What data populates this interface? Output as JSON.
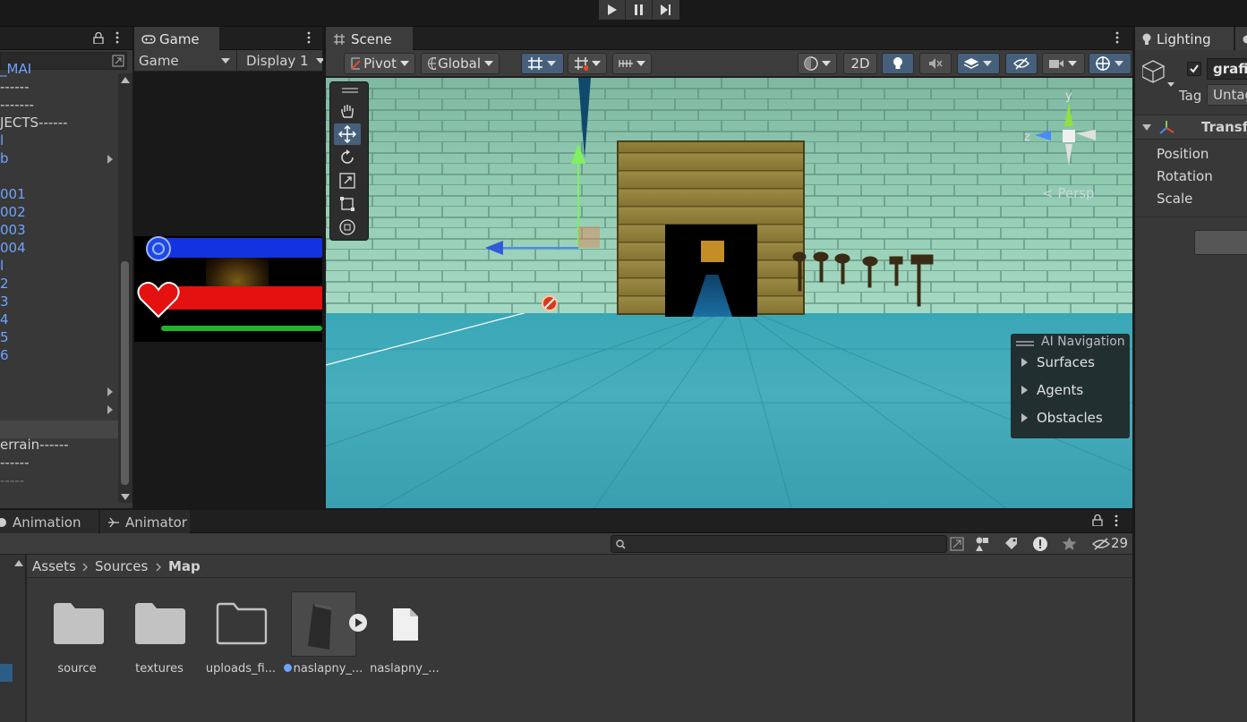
{
  "topbar": {
    "play_icon": "play-icon",
    "pause_icon": "pause-icon",
    "step_icon": "step-icon"
  },
  "hierarchy": {
    "items": [
      {
        "text": "_MAI",
        "cls": "blue"
      },
      {
        "text": "------",
        "cls": ""
      },
      {
        "text": "-------",
        "cls": ""
      },
      {
        "text": "JECTS------",
        "cls": ""
      },
      {
        "text": "l",
        "cls": "blue"
      },
      {
        "text": "b",
        "cls": "blue"
      },
      {
        "text": "",
        "cls": ""
      },
      {
        "text": "001",
        "cls": "blue"
      },
      {
        "text": "002",
        "cls": "blue"
      },
      {
        "text": "003",
        "cls": "blue"
      },
      {
        "text": "004",
        "cls": "blue"
      },
      {
        "text": "l",
        "cls": "blue"
      },
      {
        "text": "2",
        "cls": "blue"
      },
      {
        "text": "3",
        "cls": "blue"
      },
      {
        "text": "4",
        "cls": "blue"
      },
      {
        "text": "5",
        "cls": "blue"
      },
      {
        "text": "6",
        "cls": "blue"
      },
      {
        "text": "",
        "cls": ""
      },
      {
        "text": "",
        "cls": ""
      },
      {
        "text": "",
        "cls": ""
      },
      {
        "text": "",
        "cls": ""
      },
      {
        "text": "errain------",
        "cls": ""
      },
      {
        "text": "------",
        "cls": ""
      },
      {
        "text": "-----",
        "cls": "dim"
      }
    ]
  },
  "game": {
    "tab_label": "Game",
    "dropdown_game": "Game",
    "dropdown_display": "Display 1"
  },
  "scene": {
    "tab_label": "Scene",
    "pivot_label": "Pivot",
    "global_label": "Global",
    "mode_2d": "2D",
    "persp_label": "< Persp",
    "gizmo_y": "y",
    "gizmo_z": "z"
  },
  "ai_navigation": {
    "title": "AI Navigation",
    "items": [
      "Surfaces",
      "Agents",
      "Obstacles"
    ]
  },
  "inspector": {
    "tab_label": "Lighting",
    "object_name": "grafit",
    "tag_label": "Tag",
    "tag_value": "Untag",
    "transform_label": "Transfo",
    "position_label": "Position",
    "rotation_label": "Rotation",
    "scale_label": "Scale"
  },
  "bottom": {
    "tab_animation": "Animation",
    "tab_animator": "Animator",
    "hidden_count": "29",
    "breadcrumb": [
      "Assets",
      "Sources",
      "Map"
    ],
    "assets": [
      {
        "name": "source",
        "kind": "folder"
      },
      {
        "name": "textures",
        "kind": "folder"
      },
      {
        "name": "uploads_fi...",
        "kind": "folder-empty"
      },
      {
        "name": "naslapny_...",
        "kind": "model"
      },
      {
        "name": "naslapny_...",
        "kind": "file"
      }
    ]
  },
  "colors": {
    "mana_bar": "#1433e0",
    "health_bar": "#e51010",
    "stamina_bar": "#1fb42a",
    "selection": "#46607c"
  }
}
